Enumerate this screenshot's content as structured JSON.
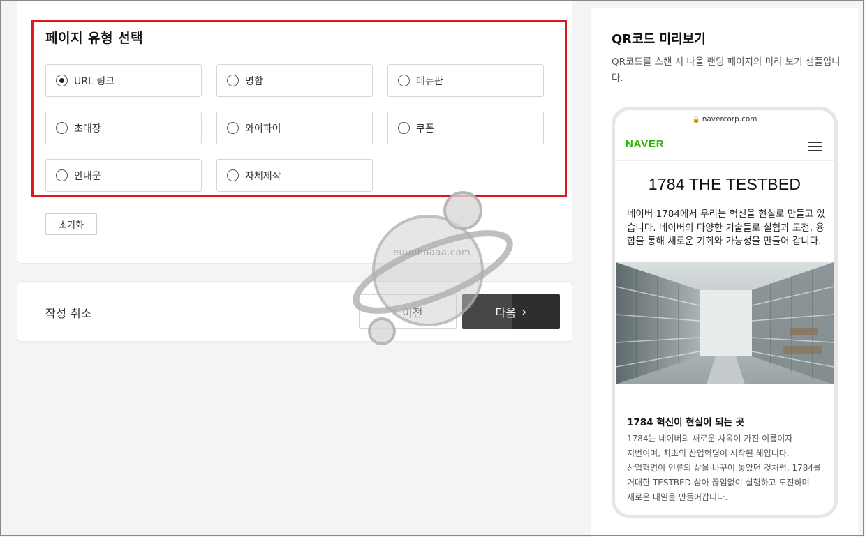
{
  "page_type_section": {
    "title": "페이지 유형 선택",
    "options": [
      {
        "label": "URL 링크",
        "checked": true
      },
      {
        "label": "명함",
        "checked": false
      },
      {
        "label": "메뉴판",
        "checked": false
      },
      {
        "label": "초대장",
        "checked": false
      },
      {
        "label": "와이파이",
        "checked": false
      },
      {
        "label": "쿠폰",
        "checked": false
      },
      {
        "label": "안내문",
        "checked": false
      },
      {
        "label": "자체제작",
        "checked": false
      }
    ],
    "reset_label": "초기화",
    "highlight_color": "#e0171d"
  },
  "footer": {
    "cancel_label": "작성 취소",
    "prev_label": "이전",
    "next_label": "다음",
    "next_button_color": "#2e2e2e"
  },
  "watermark": {
    "text": "euunhaaaa.com"
  },
  "preview": {
    "title": "QR코드 미리보기",
    "description": "QR코드를 스캔 시 나올 랜딩 페이지의 미리 보기 샘플입니다.",
    "phone": {
      "url": "navercorp.com",
      "logo": "NAVER",
      "logo_color": "#2db400",
      "headline": "1784 THE TESTBED",
      "intro": "네이버 1784에서 우리는 혁신을 현실로 만들고 있습니다. 네이버의 다양한 기술들로 실험과 도전, 융합을 통해 새로운 기회와 가능성을 만들어 갑니다.",
      "subhead": "1784 혁신이 현실이 되는 곳",
      "body_lines": [
        "1784는 네이버의 새로운 사옥이 가진 이름이자",
        "지번이며, 최초의 산업혁명이 시작된 해입니다.",
        "산업혁명이 인류의 삶을 바꾸어 놓았던 것처럼, 1784를",
        "거대한 TESTBED 삼아 끊임없이 실험하고 도전하며",
        "새로운 내일을 만들어갑니다."
      ]
    }
  }
}
